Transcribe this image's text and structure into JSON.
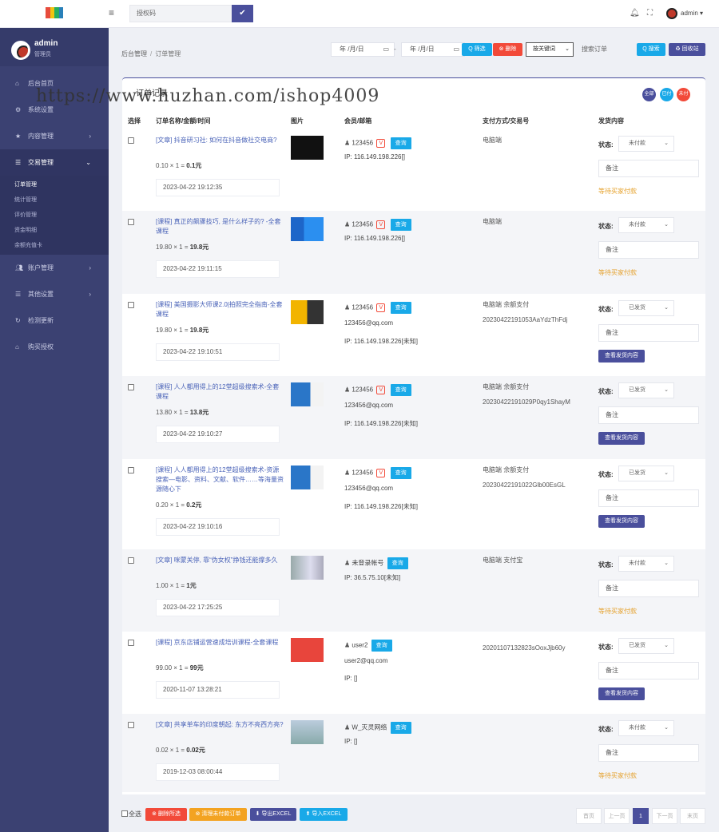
{
  "topbar": {
    "auth_placeholder": "授权码",
    "user_name": "admin ▾"
  },
  "sidebar": {
    "profile_name": "admin",
    "profile_role": "管理员",
    "items": [
      {
        "label": "后台首页",
        "icon": "home-icon"
      },
      {
        "label": "系统设置",
        "icon": "gear-icon"
      },
      {
        "label": "内容管理",
        "icon": "star-icon"
      },
      {
        "label": "交易管理",
        "icon": "list-icon"
      },
      {
        "label": "账户管理",
        "icon": "users-icon"
      },
      {
        "label": "其他设置",
        "icon": "list-icon"
      },
      {
        "label": "检测更新",
        "icon": "refresh-icon"
      },
      {
        "label": "购买授权",
        "icon": "home-icon"
      }
    ],
    "sub_items": [
      "订单管理",
      "统计管理",
      "评价管理",
      "资金明细",
      "余额充值卡"
    ]
  },
  "breadcrumb": {
    "root": "后台管理",
    "sep": "/",
    "current": "订单管理"
  },
  "filters": {
    "date_start": "年 /月/日",
    "date_end": "年 /月/日",
    "dash": "-",
    "filter_btn": "Q 筛选",
    "delete_btn": "⊗ 删除",
    "keyword_select": "按关键词",
    "search_placeholder": "搜索订单",
    "search_btn": "Q 搜索",
    "recycle_btn": "♻ 回收站"
  },
  "panel": {
    "title": "订单记录",
    "legend": [
      "全部",
      "已付",
      "未付"
    ],
    "headers": [
      "选择",
      "订单名称/金额/时间",
      "图片",
      "会员/邮箱",
      "支付方式/交易号",
      "发货内容"
    ]
  },
  "orders": [
    {
      "name": "[文章] 抖音研习社: 如何在抖音做社交电商?",
      "price": "0.10",
      "qty": "1",
      "total": "0.1元",
      "time": "2023-04-22 19:12:35",
      "member": "123456",
      "vip": true,
      "email": "",
      "ip": "IP:  116.149.198.226[]",
      "pay": "电脑端",
      "txn": "",
      "status": "未付款",
      "remark": "备注",
      "action": "等待买家付款"
    },
    {
      "name": "[课程] 真正的飙骤技巧, 是什么样子的? -全套课程",
      "price": "19.80",
      "qty": "1",
      "total": "19.8元",
      "time": "2023-04-22 19:11:15",
      "member": "123456",
      "vip": true,
      "email": "",
      "ip": "IP:  116.149.198.226[]",
      "pay": "电脑端",
      "txn": "",
      "status": "未付款",
      "remark": "备注",
      "action": "等待买家付款"
    },
    {
      "name": "[课程] 美国摄影大师课2.0|拍照完全指南-全套课程",
      "price": "19.80",
      "qty": "1",
      "total": "19.8元",
      "time": "2023-04-22 19:10:51",
      "member": "123456",
      "vip": true,
      "email": "123456@qq.com",
      "ip": "IP:  116.149.198.226[未知]",
      "pay": "电脑端 余额支付",
      "txn": "20230422191053AaYdzThFdj",
      "status": "已发货",
      "remark": "备注",
      "action": "查看发货内容"
    },
    {
      "name": "[课程] 人人都用得上的12堂超级搜索术-全套课程",
      "price": "13.80",
      "qty": "1",
      "total": "13.8元",
      "time": "2023-04-22 19:10:27",
      "member": "123456",
      "vip": true,
      "email": "123456@qq.com",
      "ip": "IP:  116.149.198.226[未知]",
      "pay": "电脑端 余额支付",
      "txn": "20230422191029P0qy1ShayM",
      "status": "已发货",
      "remark": "备注",
      "action": "查看发货内容"
    },
    {
      "name": "[课程] 人人都用得上的12堂超级搜索术-资源搜索—电影、资料、文献、软件……等海量资源随心下",
      "price": "0.20",
      "qty": "1",
      "total": "0.2元",
      "time": "2023-04-22 19:10:16",
      "member": "123456",
      "vip": true,
      "email": "123456@qq.com",
      "ip": "IP:  116.149.198.226[未知]",
      "pay": "电脑端 余额支付",
      "txn": "20230422191022Glb00EsGL",
      "status": "已发货",
      "remark": "备注",
      "action": "查看发货内容"
    },
    {
      "name": "[文章] 咪蒙关停, 靠“伪女权”挣钱还能撑多久",
      "price": "1.00",
      "qty": "1",
      "total": "1元",
      "time": "2023-04-22 17:25:25",
      "member": "未登录帐号",
      "vip": false,
      "email": "",
      "ip": "IP:  36.5.75.10[未知]",
      "pay": "电脑端 支付宝",
      "txn": "",
      "status": "未付款",
      "remark": "备注",
      "action": "等待买家付款"
    },
    {
      "name": "[课程] 京东店铺运营速成培训课程-全套课程",
      "price": "99.00",
      "qty": "1",
      "total": "99元",
      "time": "2020-11-07 13:28:21",
      "member": "user2",
      "vip": false,
      "email": "user2@qq.com",
      "ip": "IP:  []",
      "pay": "",
      "txn": "20201107132823sOoxJjb60y",
      "status": "已发货",
      "remark": "备注",
      "action": "查看发货内容"
    },
    {
      "name": "[文章] 共享单车的印度朝起: 东方不亮西方亮?",
      "price": "0.02",
      "qty": "1",
      "total": "0.02元",
      "time": "2019-12-03 08:00:44",
      "member": "W_灭灵网络",
      "vip": false,
      "email": "",
      "ip": "IP:  []",
      "pay": "",
      "txn": "",
      "status": "未付款",
      "remark": "备注",
      "action": "等待买家付款"
    }
  ],
  "common": {
    "query_btn": "查询",
    "status_label": "状态:"
  },
  "bottom": {
    "select_all": "全选",
    "delete_selected": "⊗ 删除所选",
    "clear_unpaid": "⊗ 清理未付款订单",
    "export_excel": "⬇ 导出EXCEL",
    "import_excel": "⬆ 导入EXCEL",
    "pager": [
      "首页",
      "上一页",
      "1",
      "下一页",
      "末页"
    ]
  },
  "watermark": "https://www.huzhan.com/ishop4009"
}
